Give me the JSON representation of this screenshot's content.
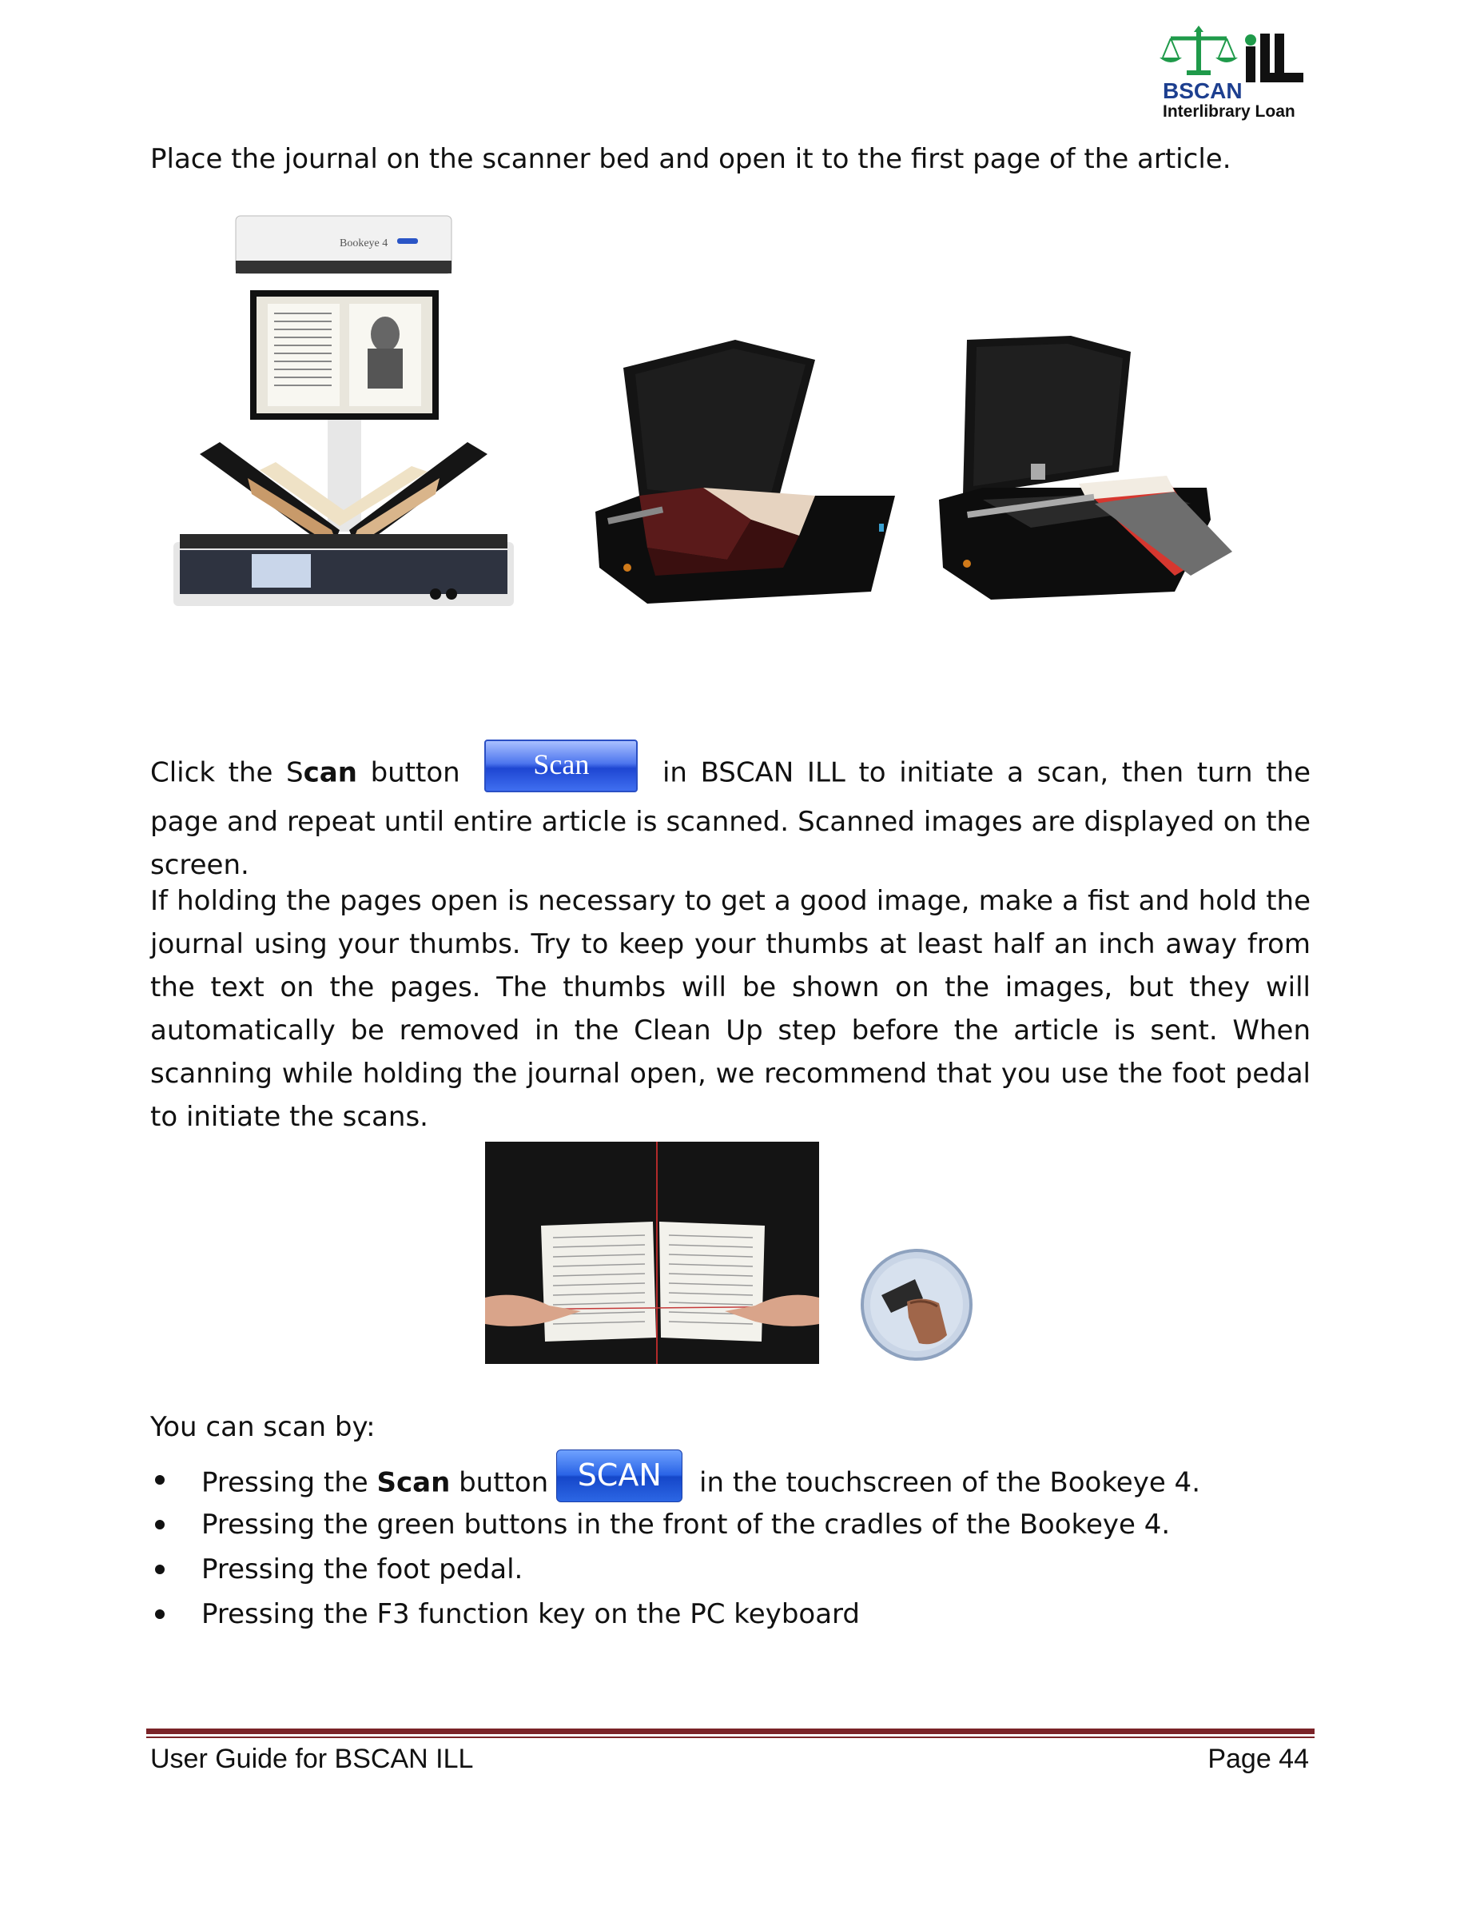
{
  "logo": {
    "text": "BSCAN",
    "subtitle": "Interlibrary Loan"
  },
  "intro": "Place the journal on the scanner bed and open it to the first page of the article.",
  "scanner_photos": {
    "bookeye_label": "Bookeye 4"
  },
  "scan_para": {
    "before": "Click the S",
    "bold": "can",
    "middle": " button ",
    "button": "Scan",
    "after": " in BSCAN ILL to initiate a scan, then turn the page and repeat until entire article is scanned.  Scanned images are displayed on the screen."
  },
  "holding_para": "If holding the pages open is necessary to get a good image, make a fist and hold the journal using your thumbs.  Try to keep your thumbs at least half an inch away from the text on the pages.  The thumbs will be shown on the images, but they will automatically be removed in the Clean Up step before the article is sent.  When scanning while holding the journal open, we recommend that you use the foot pedal to initiate the scans.",
  "scan_by_heading": "You can scan by:",
  "bullets": {
    "b1_pre": "Pressing the ",
    "b1_bold": "Scan",
    "b1_mid": " button",
    "b1_button": "SCAN",
    "b1_post": " in the touchscreen of the Bookeye 4.",
    "b2": "Pressing the green buttons in the front of the cradles of the Bookeye 4.",
    "b3": "Pressing the foot pedal.",
    "b4": "Pressing the F3 function key on the PC keyboard"
  },
  "footer": {
    "left": "User Guide for BSCAN ILL",
    "right": "Page 44"
  }
}
